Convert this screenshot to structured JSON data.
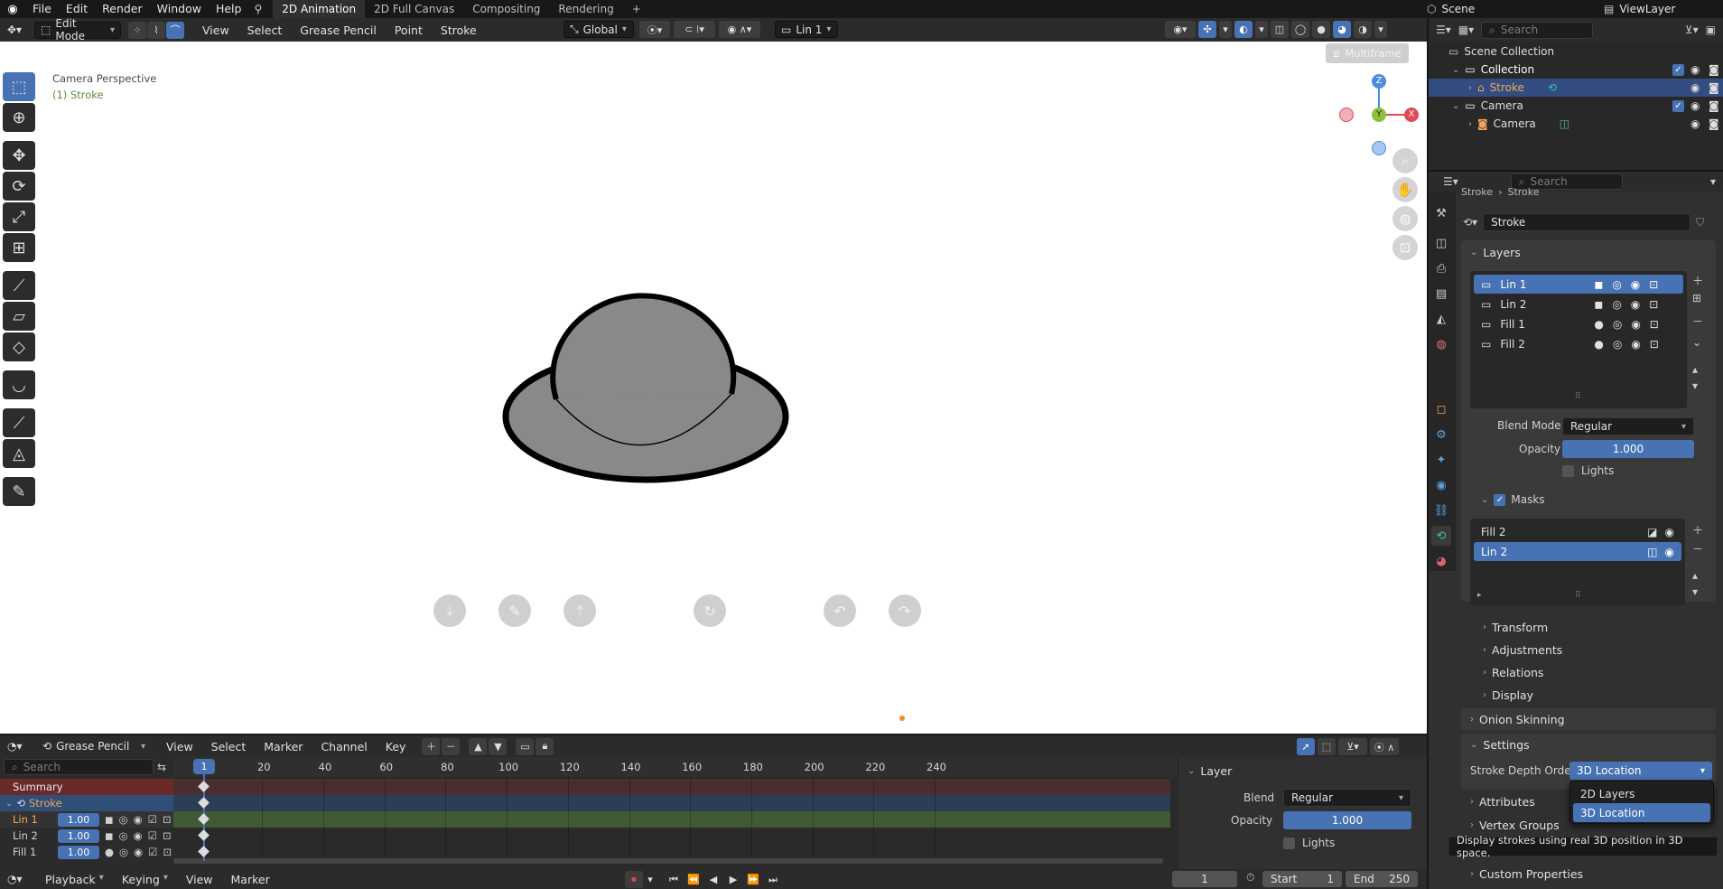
{
  "topbar": {
    "menus": [
      "File",
      "Edit",
      "Render",
      "Window",
      "Help"
    ],
    "workspaces": [
      "2D Animation",
      "2D Full Canvas",
      "Compositing",
      "Rendering"
    ],
    "active_workspace": "2D Animation",
    "add_tab": "+",
    "scene": "Scene",
    "view_layer": "ViewLayer"
  },
  "viewport_header": {
    "mode": "Edit Mode",
    "menus": [
      "View",
      "Select",
      "Grease Pencil",
      "Point",
      "Stroke"
    ],
    "transform_orientation": "Global",
    "active_layer": "Lin 1",
    "multiframe": "Multiframe"
  },
  "viewport": {
    "camera_label": "Camera Perspective",
    "object_label": "(1) Stroke",
    "axes": {
      "z": "Z",
      "y": "Y",
      "x": "X"
    }
  },
  "outliner": {
    "search_placeholder": "Search",
    "scene_collection": "Scene Collection",
    "items": [
      {
        "label": "Collection"
      },
      {
        "label": "Stroke"
      },
      {
        "label": "Camera"
      },
      {
        "label": "Camera"
      }
    ]
  },
  "properties": {
    "search_placeholder": "Search",
    "breadcrumb_left": "Stroke",
    "breadcrumb_right": "Stroke",
    "data_name": "Stroke",
    "layers_title": "Layers",
    "layers": [
      {
        "name": "Lin 1",
        "selected": true
      },
      {
        "name": "Lin 2",
        "selected": false
      },
      {
        "name": "Fill 1",
        "selected": false
      },
      {
        "name": "Fill 2",
        "selected": false
      }
    ],
    "blend_mode_label": "Blend Mode",
    "blend_mode_value": "Regular",
    "opacity_label": "Opacity",
    "opacity_value": "1.000",
    "lights_label": "Lights",
    "masks_label": "Masks",
    "masks": [
      {
        "name": "Fill 2",
        "selected": false
      },
      {
        "name": "Lin 2",
        "selected": true
      }
    ],
    "subpanels": [
      "Transform",
      "Adjustments",
      "Relations",
      "Display"
    ],
    "onion_skinning": "Onion Skinning",
    "settings": "Settings",
    "stroke_depth_order_label": "Stroke Depth Order",
    "stroke_depth_order_value": "3D Location",
    "dropdown_options": [
      "2D Layers",
      "3D Location"
    ],
    "tooltip": "Display strokes using real 3D position in 3D space.",
    "attributes": "Attributes",
    "vertex_groups": "Vertex Groups",
    "custom_properties": "Custom Properties"
  },
  "dopesheet": {
    "mode": "Grease Pencil",
    "menus": [
      "View",
      "Select",
      "Marker",
      "Channel",
      "Key"
    ],
    "search_placeholder": "Search",
    "current_frame_badge": "1",
    "frame_ticks": [
      "20",
      "40",
      "60",
      "80",
      "100",
      "120",
      "140",
      "160",
      "180",
      "200",
      "220",
      "240"
    ],
    "channels": {
      "summary": "Summary",
      "object": "Stroke",
      "layers": [
        {
          "name": "Lin 1",
          "value": "1.00"
        },
        {
          "name": "Lin 2",
          "value": "1.00"
        },
        {
          "name": "Fill 1",
          "value": "1.00"
        }
      ]
    },
    "side_panel": {
      "title": "Layer",
      "blend_label": "Blend",
      "blend_value": "Regular",
      "opacity_label": "Opacity",
      "opacity_value": "1.000",
      "lights_label": "Lights"
    }
  },
  "statusbar": {
    "menus": [
      "Playback",
      "Keying",
      "View",
      "Marker"
    ],
    "current_frame": "1",
    "start_label": "Start",
    "start_value": "1",
    "end_label": "End",
    "end_value": "250"
  },
  "colors": {
    "accent": "#4772b3",
    "active_object": "#f0a65a",
    "viewport_bg": "#ffffff",
    "shape_fill": "#898989"
  }
}
